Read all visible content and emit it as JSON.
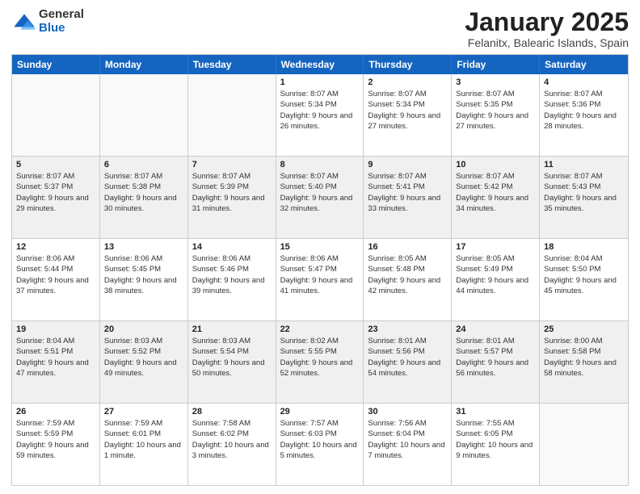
{
  "header": {
    "logo": {
      "general": "General",
      "blue": "Blue"
    },
    "title": "January 2025",
    "location": "Felanitx, Balearic Islands, Spain"
  },
  "weekdays": [
    "Sunday",
    "Monday",
    "Tuesday",
    "Wednesday",
    "Thursday",
    "Friday",
    "Saturday"
  ],
  "weeks": [
    [
      {
        "day": "",
        "info": ""
      },
      {
        "day": "",
        "info": ""
      },
      {
        "day": "",
        "info": ""
      },
      {
        "day": "1",
        "info": "Sunrise: 8:07 AM\nSunset: 5:34 PM\nDaylight: 9 hours and 26 minutes."
      },
      {
        "day": "2",
        "info": "Sunrise: 8:07 AM\nSunset: 5:34 PM\nDaylight: 9 hours and 27 minutes."
      },
      {
        "day": "3",
        "info": "Sunrise: 8:07 AM\nSunset: 5:35 PM\nDaylight: 9 hours and 27 minutes."
      },
      {
        "day": "4",
        "info": "Sunrise: 8:07 AM\nSunset: 5:36 PM\nDaylight: 9 hours and 28 minutes."
      }
    ],
    [
      {
        "day": "5",
        "info": "Sunrise: 8:07 AM\nSunset: 5:37 PM\nDaylight: 9 hours and 29 minutes."
      },
      {
        "day": "6",
        "info": "Sunrise: 8:07 AM\nSunset: 5:38 PM\nDaylight: 9 hours and 30 minutes."
      },
      {
        "day": "7",
        "info": "Sunrise: 8:07 AM\nSunset: 5:39 PM\nDaylight: 9 hours and 31 minutes."
      },
      {
        "day": "8",
        "info": "Sunrise: 8:07 AM\nSunset: 5:40 PM\nDaylight: 9 hours and 32 minutes."
      },
      {
        "day": "9",
        "info": "Sunrise: 8:07 AM\nSunset: 5:41 PM\nDaylight: 9 hours and 33 minutes."
      },
      {
        "day": "10",
        "info": "Sunrise: 8:07 AM\nSunset: 5:42 PM\nDaylight: 9 hours and 34 minutes."
      },
      {
        "day": "11",
        "info": "Sunrise: 8:07 AM\nSunset: 5:43 PM\nDaylight: 9 hours and 35 minutes."
      }
    ],
    [
      {
        "day": "12",
        "info": "Sunrise: 8:06 AM\nSunset: 5:44 PM\nDaylight: 9 hours and 37 minutes."
      },
      {
        "day": "13",
        "info": "Sunrise: 8:06 AM\nSunset: 5:45 PM\nDaylight: 9 hours and 38 minutes."
      },
      {
        "day": "14",
        "info": "Sunrise: 8:06 AM\nSunset: 5:46 PM\nDaylight: 9 hours and 39 minutes."
      },
      {
        "day": "15",
        "info": "Sunrise: 8:06 AM\nSunset: 5:47 PM\nDaylight: 9 hours and 41 minutes."
      },
      {
        "day": "16",
        "info": "Sunrise: 8:05 AM\nSunset: 5:48 PM\nDaylight: 9 hours and 42 minutes."
      },
      {
        "day": "17",
        "info": "Sunrise: 8:05 AM\nSunset: 5:49 PM\nDaylight: 9 hours and 44 minutes."
      },
      {
        "day": "18",
        "info": "Sunrise: 8:04 AM\nSunset: 5:50 PM\nDaylight: 9 hours and 45 minutes."
      }
    ],
    [
      {
        "day": "19",
        "info": "Sunrise: 8:04 AM\nSunset: 5:51 PM\nDaylight: 9 hours and 47 minutes."
      },
      {
        "day": "20",
        "info": "Sunrise: 8:03 AM\nSunset: 5:52 PM\nDaylight: 9 hours and 49 minutes."
      },
      {
        "day": "21",
        "info": "Sunrise: 8:03 AM\nSunset: 5:54 PM\nDaylight: 9 hours and 50 minutes."
      },
      {
        "day": "22",
        "info": "Sunrise: 8:02 AM\nSunset: 5:55 PM\nDaylight: 9 hours and 52 minutes."
      },
      {
        "day": "23",
        "info": "Sunrise: 8:01 AM\nSunset: 5:56 PM\nDaylight: 9 hours and 54 minutes."
      },
      {
        "day": "24",
        "info": "Sunrise: 8:01 AM\nSunset: 5:57 PM\nDaylight: 9 hours and 56 minutes."
      },
      {
        "day": "25",
        "info": "Sunrise: 8:00 AM\nSunset: 5:58 PM\nDaylight: 9 hours and 58 minutes."
      }
    ],
    [
      {
        "day": "26",
        "info": "Sunrise: 7:59 AM\nSunset: 5:59 PM\nDaylight: 9 hours and 59 minutes."
      },
      {
        "day": "27",
        "info": "Sunrise: 7:59 AM\nSunset: 6:01 PM\nDaylight: 10 hours and 1 minute."
      },
      {
        "day": "28",
        "info": "Sunrise: 7:58 AM\nSunset: 6:02 PM\nDaylight: 10 hours and 3 minutes."
      },
      {
        "day": "29",
        "info": "Sunrise: 7:57 AM\nSunset: 6:03 PM\nDaylight: 10 hours and 5 minutes."
      },
      {
        "day": "30",
        "info": "Sunrise: 7:56 AM\nSunset: 6:04 PM\nDaylight: 10 hours and 7 minutes."
      },
      {
        "day": "31",
        "info": "Sunrise: 7:55 AM\nSunset: 6:05 PM\nDaylight: 10 hours and 9 minutes."
      },
      {
        "day": "",
        "info": ""
      }
    ]
  ]
}
